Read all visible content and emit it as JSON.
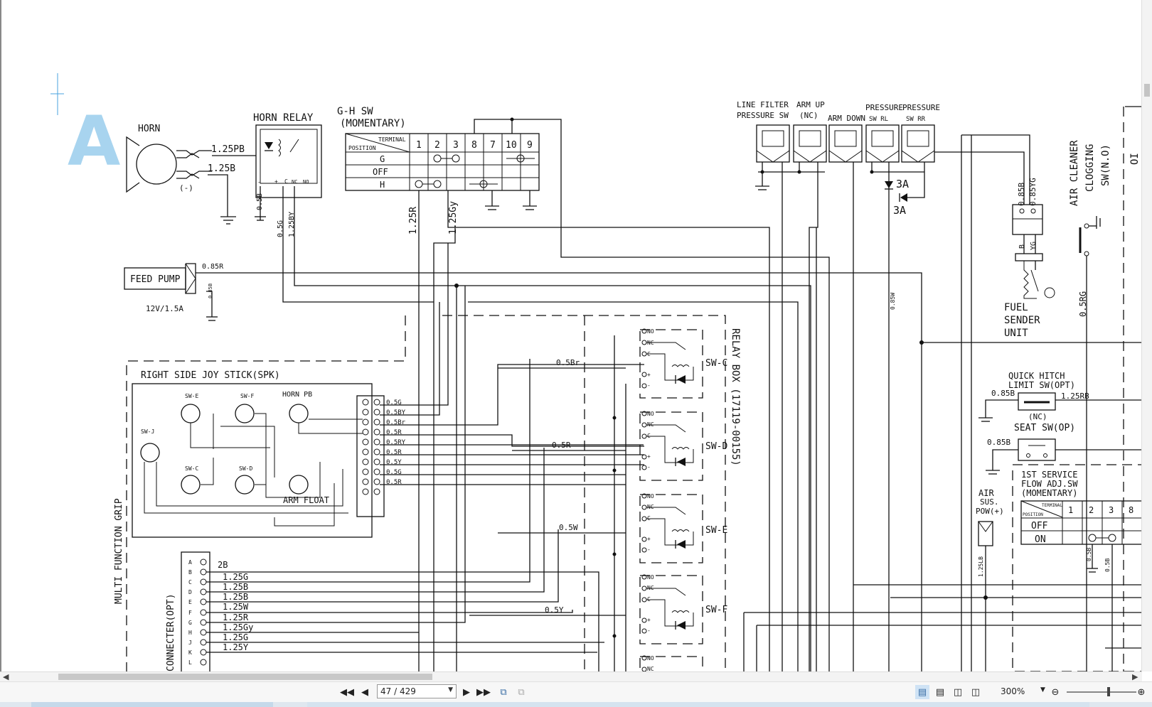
{
  "toolbar": {
    "page_value": "47 / 429",
    "zoom_value": "300%"
  },
  "schematic": {
    "section_letter": "A",
    "horn": {
      "title": "HORN",
      "ground_label": "(-)",
      "wire_1": "1.25PB",
      "wire_2": "1.25B"
    },
    "horn_relay": {
      "title": "HORN RELAY",
      "pins": [
        "+",
        "C",
        "NC",
        "NO"
      ],
      "wire_ground": "0.5B",
      "wire_1": "0.5G",
      "wire_2": "1.25BY"
    },
    "gh_switch": {
      "title": "G-H SW",
      "subtitle": "(MOMENTARY)",
      "header_terminal": "TERMINAL",
      "header_position": "POSITION",
      "terminals": [
        "1",
        "2",
        "3",
        "8",
        "7",
        "10",
        "9"
      ],
      "positions": [
        "G",
        "OFF",
        "H"
      ],
      "wire_1": "1.25R",
      "wire_2": "1.25Gy"
    },
    "feed_pump": {
      "title": "FEED PUMP",
      "rating": "12V/1.5A",
      "wire": "0.85R",
      "ground_wire": "0.85B"
    },
    "joystick": {
      "title": "RIGHT SIDE JOY STICK(SPK)",
      "switches": [
        "SW-E",
        "SW-F",
        "HORN PB",
        "SW-J",
        "SW-C",
        "SW-D",
        "ARM FLOAT"
      ],
      "pin_wires": [
        "0.5G",
        "0.5BY",
        "0.5Br",
        "0.5R",
        "0.5RY",
        "0.5R",
        "0.5Y",
        "0.5G",
        "0.5R"
      ]
    },
    "multi_function_label": "MULTI FUNCTION GRIP",
    "connector": {
      "title": "CONNECTER(OPT)",
      "pins": [
        "A",
        "B",
        "C",
        "D",
        "E",
        "F",
        "G",
        "H",
        "J",
        "K",
        "L"
      ],
      "wires": [
        "2B",
        "1.25G",
        "1.25B",
        "1.25B",
        "1.25W",
        "1.25R",
        "1.25Gy",
        "1.25G",
        "1.25Y"
      ]
    },
    "relay_box": {
      "title": "RELAY BOX (17119-00155)",
      "terminals": [
        "NO",
        "NC",
        "C",
        "+",
        "-"
      ],
      "relays": [
        {
          "name": "SW-C",
          "wire": "0.5Br"
        },
        {
          "name": "SW-D",
          "wire": "0.5R"
        },
        {
          "name": "SW-E",
          "wire": "0.5W"
        },
        {
          "name": "SW-F",
          "wire": "0.5Y"
        }
      ]
    },
    "pressure_switches": {
      "line_filter": [
        "LINE FILTER",
        "PRESSURE SW"
      ],
      "arm_up": [
        "ARM UP",
        "(NC)"
      ],
      "arm_down": "ARM DOWN",
      "pressure_rl": [
        "PRESSURE",
        "SW RL"
      ],
      "pressure_rr": [
        "PRESSURE",
        "SW RR"
      ],
      "diode_1": "3A",
      "diode_2": "3A",
      "wire_mid": "0.85W"
    },
    "fuel_sender": {
      "lines": [
        "FUEL",
        "SENDER",
        "UNIT"
      ],
      "wire_1": "0.85B",
      "wire_2": "0.85YG",
      "pin_b": "B",
      "pin_yg": "YG"
    },
    "air_cleaner": {
      "lines": [
        "AIR CLEANER",
        "CLOGGING",
        "SW(N.O)"
      ],
      "wire": "0.5RG",
      "cut_label": "OI"
    },
    "quick_hitch": {
      "lines": [
        "QUICK HITCH",
        "LIMIT SW(OPT)"
      ],
      "wire_left": "0.85B",
      "wire_right": "1.25RB",
      "state": "(NC)"
    },
    "seat_sw": {
      "title": "SEAT SW(OP)",
      "wire": "0.85B"
    },
    "air_sus": {
      "lines": [
        "AIR",
        "SUS.",
        "POW(+)"
      ],
      "wire": "1.25LB"
    },
    "first_service": {
      "lines": [
        "1ST SERVICE",
        "FLOW ADJ.SW",
        "(MOMENTARY)"
      ],
      "header_terminal": "TERMINAL",
      "header_position": "POSITION",
      "terminals": [
        "1",
        "2",
        "3",
        "8"
      ],
      "positions": [
        "OFF",
        "ON"
      ],
      "wire_1": "0.5B",
      "wire_2": "0.5B"
    }
  }
}
